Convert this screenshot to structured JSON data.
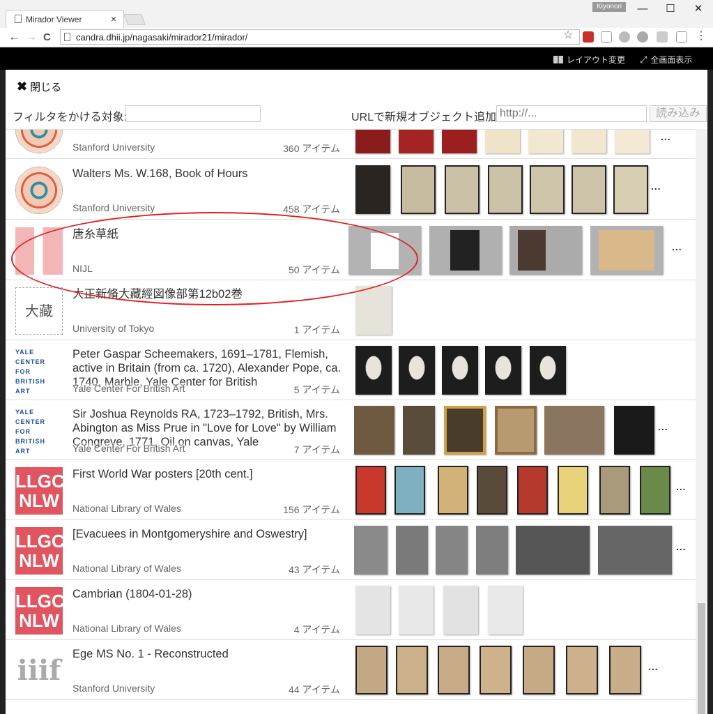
{
  "browser": {
    "tab_title": "Mirador Viewer",
    "tab_close": "×",
    "user": "Kiyonori",
    "minimize": "—",
    "maximize": "☐",
    "close": "✕",
    "back": "←",
    "forward": "→",
    "reload": "C",
    "url": "candra.dhii.jp/nagasaki/mirador21/mirador/",
    "star": "☆"
  },
  "app_header": {
    "layout_label": "レイアウト変更",
    "fullscreen_label": "全画面表示"
  },
  "dialog": {
    "close_label": "閉じる",
    "close_glyph": "✖",
    "filter_label": "フィルタをかける対象:",
    "filter_value": "",
    "url_label": "URLで新規オブジェクト追加:",
    "url_placeholder": "http://...",
    "load_button": "読み込み"
  },
  "rows": [
    {
      "title": "",
      "provider": "Stanford University",
      "count": "360 アイテム",
      "logo": "rosette-logo",
      "more": "..."
    },
    {
      "title": "Walters Ms. W.168, Book of Hours",
      "provider": "Stanford University",
      "count": "458 アイテム",
      "logo": "rosette-logo",
      "more": "..."
    },
    {
      "title": "唐糸草紙",
      "provider": "NIJL",
      "count": "50 アイテム",
      "logo": "nijl-logo",
      "more": "..."
    },
    {
      "title": "大正新脩大藏經図像部第12b02巻",
      "provider": "University of Tokyo",
      "count": "1 アイテム",
      "logo": "tokyo-logo",
      "more": ""
    },
    {
      "title": "Peter Gaspar Scheemakers, 1691–1781, Flemish, active in Britain (from ca. 1720), Alexander Pope, ca. 1740, Marble, Yale Center for British",
      "provider": "Yale Center For British Art",
      "count": "5 アイテム",
      "logo": "yale-logo",
      "more": ""
    },
    {
      "title": "Sir Joshua Reynolds RA, 1723–1792, British, Mrs. Abington as Miss Prue in \"Love for Love\" by William Congreve, 1771, Oil on canvas, Yale",
      "provider": "Yale Center For British Art",
      "count": "7 アイテム",
      "logo": "yale-logo",
      "more": "..."
    },
    {
      "title": "First World War posters [20th cent.]",
      "provider": "National Library of Wales",
      "count": "156 アイテム",
      "logo": "lgc-nlw-logo",
      "more": "..."
    },
    {
      "title": "[Evacuees in Montgomeryshire and Oswestry]",
      "provider": "National Library of Wales",
      "count": "43 アイテム",
      "logo": "lgc-nlw-logo",
      "more": "..."
    },
    {
      "title": "Cambrian (1804-01-28)",
      "provider": "National Library of Wales",
      "count": "4 アイテム",
      "logo": "lgc-nlw-logo",
      "more": ""
    },
    {
      "title": "Ege MS No. 1 - Reconstructed",
      "provider": "Stanford University",
      "count": "44 アイテム",
      "logo": "iiif-logo",
      "more": "..."
    }
  ],
  "logo_text": {
    "yale": "YALE\nCENTER\nFOR\nBRITISH\nART",
    "lgc": "LLGC\nNLW",
    "tokyo": "大藏",
    "iiif": "iiif"
  },
  "colors": {
    "accent_red": "#e21f1f",
    "nlw_red": "#e0555f",
    "yale_blue": "#1c4fa0"
  }
}
